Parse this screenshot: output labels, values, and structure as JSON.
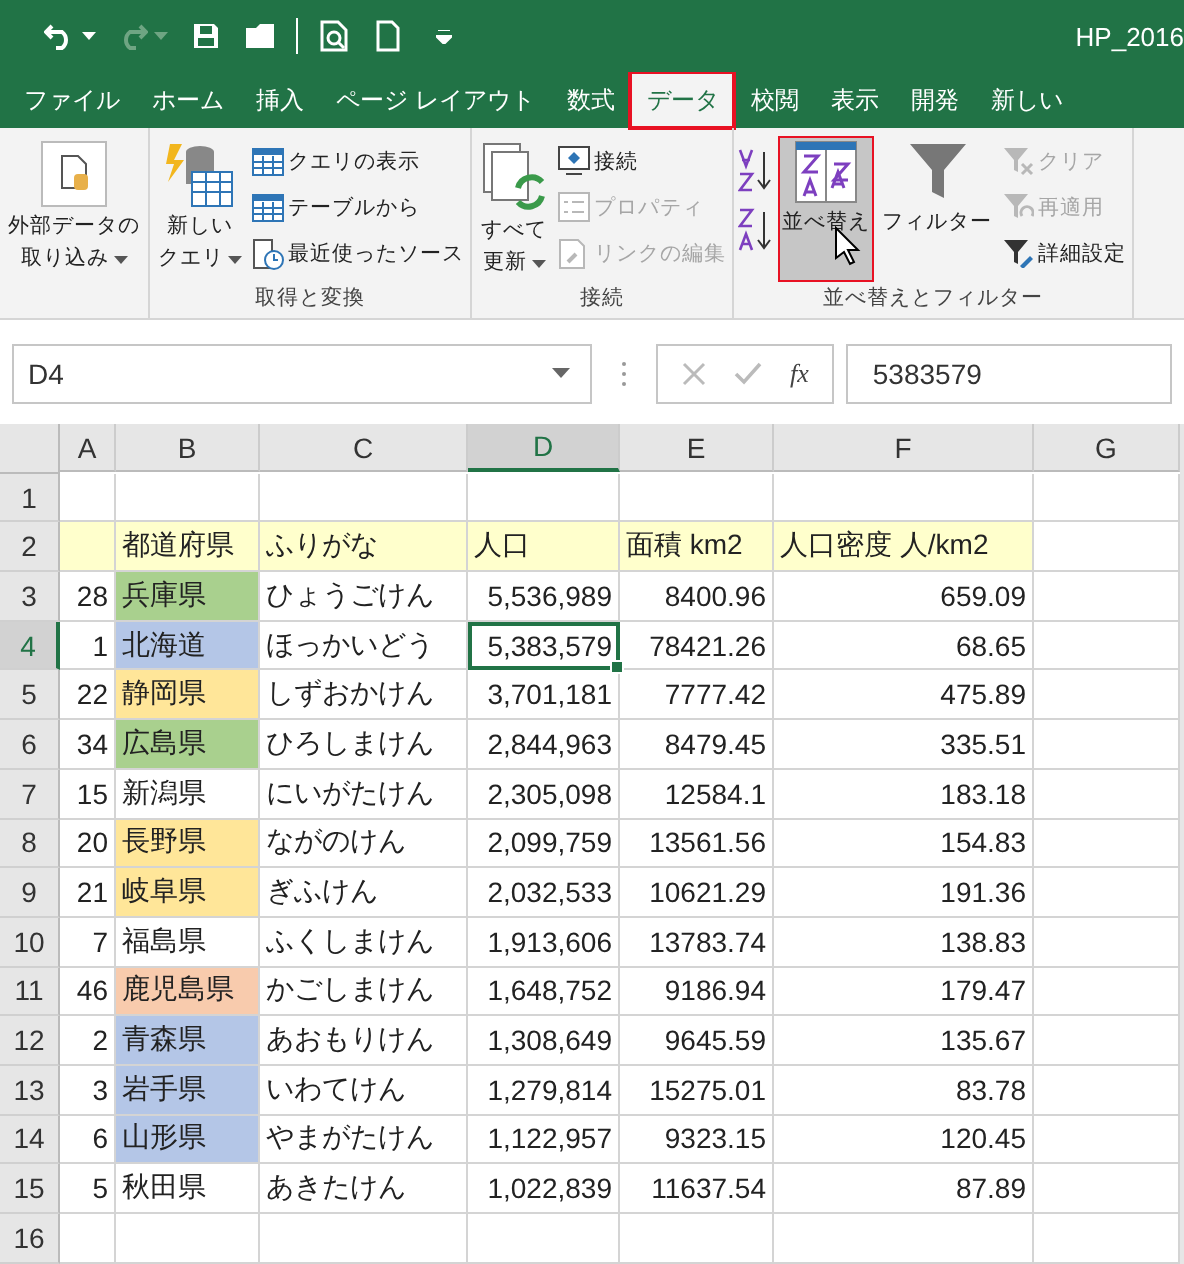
{
  "window": {
    "title": "HP_2016"
  },
  "tabs": [
    {
      "label": "ファイル",
      "selected": false,
      "outlined": false
    },
    {
      "label": "ホーム",
      "selected": false,
      "outlined": false
    },
    {
      "label": "挿入",
      "selected": false,
      "outlined": false
    },
    {
      "label": "ページ レイアウト",
      "selected": false,
      "outlined": false
    },
    {
      "label": "数式",
      "selected": false,
      "outlined": false
    },
    {
      "label": "データ",
      "selected": true,
      "outlined": true
    },
    {
      "label": "校閲",
      "selected": false,
      "outlined": false
    },
    {
      "label": "表示",
      "selected": false,
      "outlined": false
    },
    {
      "label": "開発",
      "selected": false,
      "outlined": false
    },
    {
      "label": "新しい",
      "selected": false,
      "outlined": false
    }
  ],
  "ribbon": [
    {
      "buttons": [
        {
          "kind": "large",
          "lines": [
            "外部データの",
            "取り込み"
          ],
          "dropdown": true
        }
      ]
    },
    {
      "label": "取得と変換",
      "buttons": [
        {
          "kind": "large",
          "lines": [
            "新しい",
            "クエリ"
          ],
          "dropdown": true
        },
        {
          "kind": "small",
          "label": "クエリの表示",
          "disabled": false
        },
        {
          "kind": "small",
          "label": "テーブルから",
          "disabled": false
        },
        {
          "kind": "small",
          "label": "最近使ったソース",
          "disabled": false
        }
      ]
    },
    {
      "label": "接続",
      "buttons": [
        {
          "kind": "large",
          "lines": [
            "すべて",
            "更新"
          ],
          "dropdown": true
        },
        {
          "kind": "small",
          "label": "接続",
          "disabled": false
        },
        {
          "kind": "small",
          "label": "プロパティ",
          "disabled": true
        },
        {
          "kind": "small",
          "label": "リンクの編集",
          "disabled": true
        }
      ]
    },
    {
      "label": "並べ替えとフィルター",
      "buttons": [
        {
          "kind": "sortpair"
        },
        {
          "kind": "large",
          "lines": [
            "並べ替え"
          ],
          "pressed": true,
          "outlined": true
        },
        {
          "kind": "large",
          "lines": [
            "フィルター"
          ],
          "pressed": false,
          "outlined": false
        },
        {
          "kind": "small",
          "label": "クリア",
          "disabled": true
        },
        {
          "kind": "small",
          "label": "再適用",
          "disabled": true
        },
        {
          "kind": "small",
          "label": "詳細設定",
          "disabled": false
        }
      ]
    }
  ],
  "formula_bar": {
    "name_box": "D4",
    "function_button": "fx",
    "value": "5383579"
  },
  "columns": [
    {
      "label": "A",
      "selected": false
    },
    {
      "label": "B",
      "selected": false
    },
    {
      "label": "C",
      "selected": false
    },
    {
      "label": "D",
      "selected": true
    },
    {
      "label": "E",
      "selected": false
    },
    {
      "label": "F",
      "selected": false
    },
    {
      "label": "G",
      "selected": false
    }
  ],
  "rows": [
    {
      "number": "1",
      "kind": "empty",
      "selected": false
    },
    {
      "number": "2",
      "kind": "header",
      "selected": false,
      "cells": [
        "",
        "都道府県",
        "ふりがな",
        "人口",
        "面積 km2",
        "人口密度 人/km2"
      ]
    },
    {
      "number": "3",
      "kind": "data",
      "selected": false,
      "color": "#a9d08e",
      "cells": [
        "28",
        "兵庫県",
        "ひょうごけん",
        "5,536,989",
        "8400.96",
        "659.09"
      ]
    },
    {
      "number": "4",
      "kind": "data",
      "selected": true,
      "color": "#b4c6e7",
      "cells": [
        "1",
        "北海道",
        "ほっかいどう",
        "5,383,579",
        "78421.26",
        "68.65"
      ]
    },
    {
      "number": "5",
      "kind": "data",
      "selected": false,
      "color": "#ffe699",
      "cells": [
        "22",
        "静岡県",
        "しずおかけん",
        "3,701,181",
        "7777.42",
        "475.89"
      ]
    },
    {
      "number": "6",
      "kind": "data",
      "selected": false,
      "color": "#a9d08e",
      "cells": [
        "34",
        "広島県",
        "ひろしまけん",
        "2,844,963",
        "8479.45",
        "335.51"
      ]
    },
    {
      "number": "7",
      "kind": "data",
      "selected": false,
      "cells": [
        "15",
        "新潟県",
        "にいがたけん",
        "2,305,098",
        "12584.1",
        "183.18"
      ]
    },
    {
      "number": "8",
      "kind": "data",
      "selected": false,
      "color": "#ffe699",
      "cells": [
        "20",
        "長野県",
        "ながのけん",
        "2,099,759",
        "13561.56",
        "154.83"
      ]
    },
    {
      "number": "9",
      "kind": "data",
      "selected": false,
      "color": "#ffe699",
      "cells": [
        "21",
        "岐阜県",
        "ぎふけん",
        "2,032,533",
        "10621.29",
        "191.36"
      ]
    },
    {
      "number": "10",
      "kind": "data",
      "selected": false,
      "cells": [
        "7",
        "福島県",
        "ふくしまけん",
        "1,913,606",
        "13783.74",
        "138.83"
      ]
    },
    {
      "number": "11",
      "kind": "data",
      "selected": false,
      "color": "#f8cbad",
      "cells": [
        "46",
        "鹿児島県",
        "かごしまけん",
        "1,648,752",
        "9186.94",
        "179.47"
      ]
    },
    {
      "number": "12",
      "kind": "data",
      "selected": false,
      "color": "#b4c6e7",
      "cells": [
        "2",
        "青森県",
        "あおもりけん",
        "1,308,649",
        "9645.59",
        "135.67"
      ]
    },
    {
      "number": "13",
      "kind": "data",
      "selected": false,
      "color": "#b4c6e7",
      "cells": [
        "3",
        "岩手県",
        "いわてけん",
        "1,279,814",
        "15275.01",
        "83.78"
      ]
    },
    {
      "number": "14",
      "kind": "data",
      "selected": false,
      "color": "#b4c6e7",
      "cells": [
        "6",
        "山形県",
        "やまがたけん",
        "1,122,957",
        "9323.15",
        "120.45"
      ]
    },
    {
      "number": "15",
      "kind": "data",
      "selected": false,
      "cells": [
        "5",
        "秋田県",
        "あきたけん",
        "1,022,839",
        "11637.54",
        "87.89"
      ]
    },
    {
      "number": "16",
      "kind": "empty",
      "selected": false
    }
  ]
}
